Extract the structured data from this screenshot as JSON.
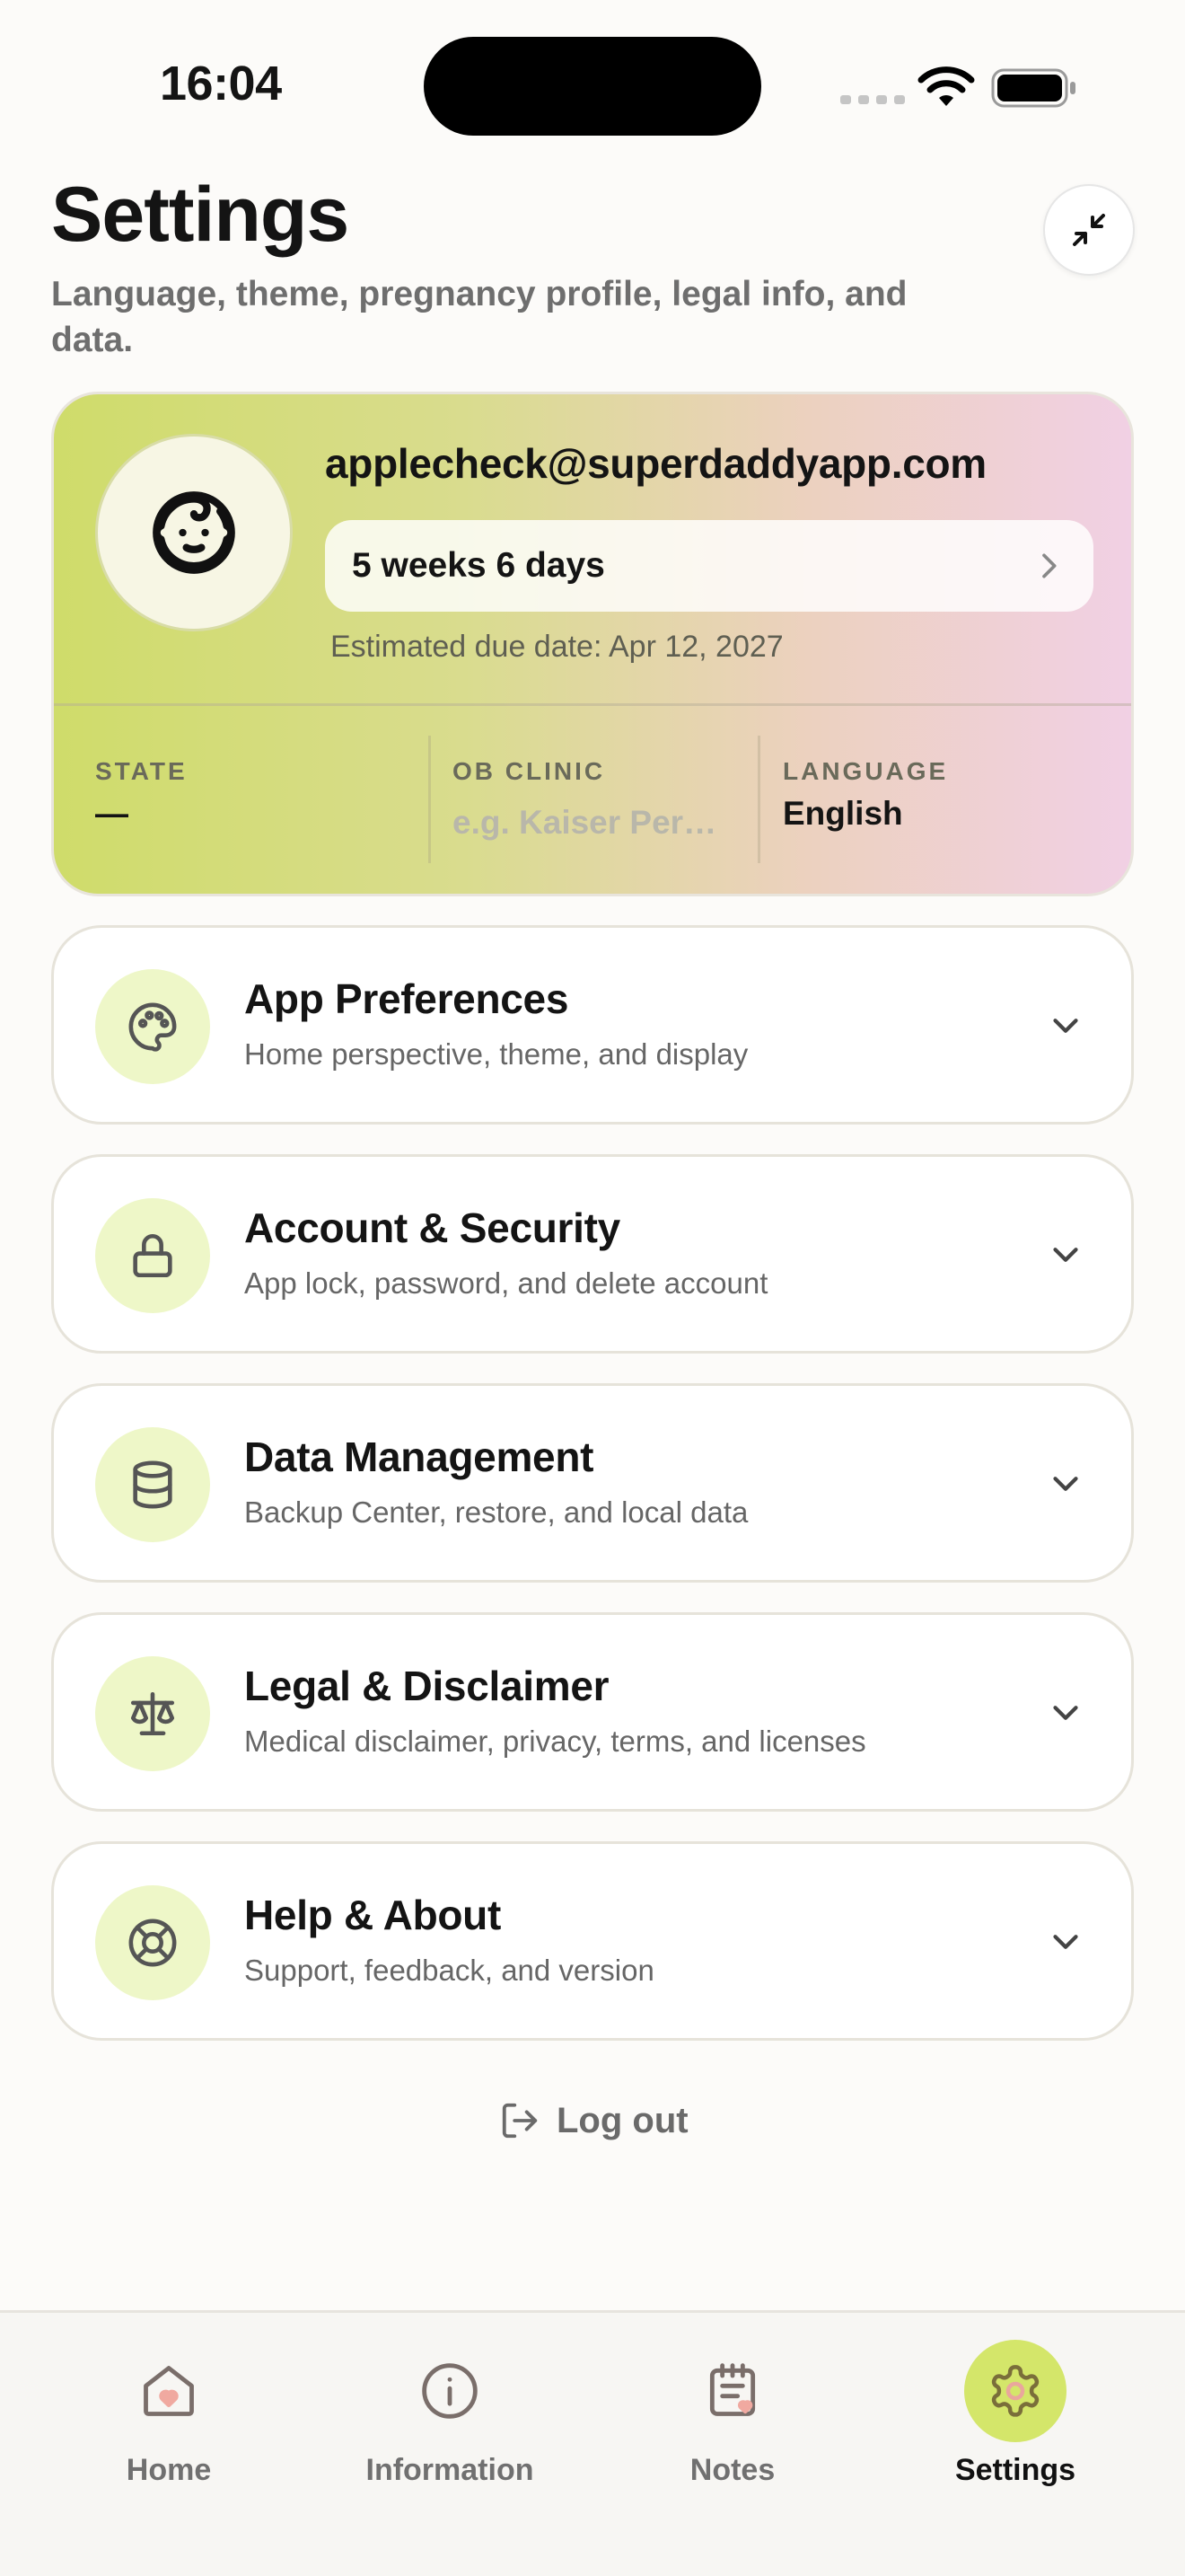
{
  "status_bar": {
    "time": "16:04"
  },
  "header": {
    "title": "Settings",
    "subtitle": "Language, theme, pregnancy profile, legal info, and data."
  },
  "profile": {
    "email": "applecheck@superdaddyapp.com",
    "pregnancy_progress": "5 weeks 6 days",
    "due_date": "Estimated due date: Apr 12, 2027",
    "stats": {
      "state_label": "STATE",
      "state_value": "—",
      "clinic_label": "OB CLINIC",
      "clinic_placeholder": "e.g. Kaiser Permanente",
      "language_label": "LANGUAGE",
      "language_value": "English"
    }
  },
  "sections": [
    {
      "title": "App Preferences",
      "subtitle": "Home perspective, theme, and display",
      "icon": "palette-icon"
    },
    {
      "title": "Account & Security",
      "subtitle": "App lock, password, and delete account",
      "icon": "lock-icon"
    },
    {
      "title": "Data Management",
      "subtitle": "Backup Center, restore, and local data",
      "icon": "database-icon"
    },
    {
      "title": "Legal & Disclaimer",
      "subtitle": "Medical disclaimer, privacy, terms, and licenses",
      "icon": "scale-icon"
    },
    {
      "title": "Help & About",
      "subtitle": "Support, feedback, and version",
      "icon": "lifebuoy-icon"
    }
  ],
  "logout_label": "Log out",
  "tabs": [
    {
      "label": "Home",
      "icon": "home-heart-icon",
      "active": false
    },
    {
      "label": "Information",
      "icon": "info-icon",
      "active": false
    },
    {
      "label": "Notes",
      "icon": "notes-icon",
      "active": false
    },
    {
      "label": "Settings",
      "icon": "gear-icon",
      "active": true
    }
  ],
  "colors": {
    "accent": "#d4e66a",
    "icon_bg": "#eef7c8",
    "card_gradient_start": "#cfdc6a",
    "card_gradient_end": "#f1d0e4"
  }
}
